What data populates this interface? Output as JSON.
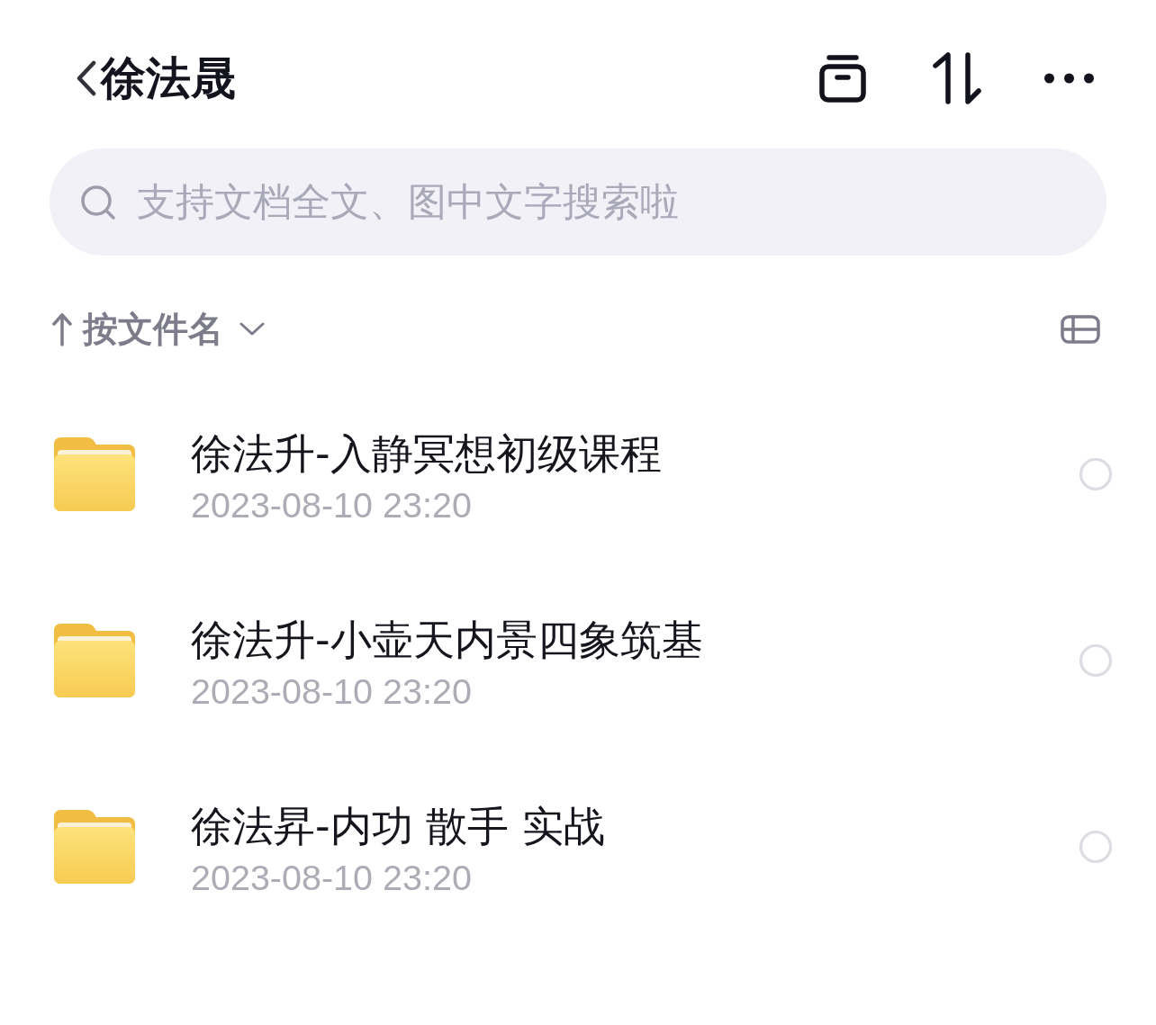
{
  "header": {
    "title": "徐法晟"
  },
  "search": {
    "placeholder": "支持文档全文、图中文字搜索啦"
  },
  "sort": {
    "label": "按文件名"
  },
  "files": [
    {
      "name": "徐法升-入静冥想初级课程",
      "modified": "2023-08-10 23:20",
      "selected": false
    },
    {
      "name": "徐法升-小壶天内景四象筑基",
      "modified": "2023-08-10 23:20",
      "selected": false
    },
    {
      "name": "徐法昇-内功 散手 实战",
      "modified": "2023-08-10 23:20",
      "selected": false
    }
  ]
}
